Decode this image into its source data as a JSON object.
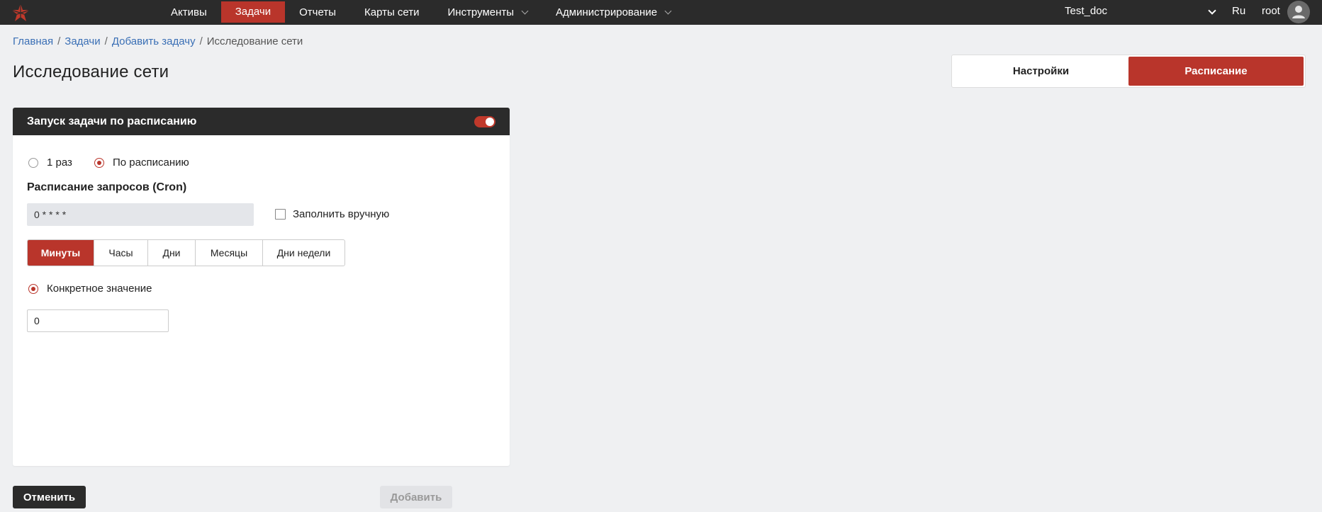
{
  "nav": {
    "items": [
      {
        "label": "Активы",
        "active": false,
        "has_dropdown": false
      },
      {
        "label": "Задачи",
        "active": true,
        "has_dropdown": false
      },
      {
        "label": "Отчеты",
        "active": false,
        "has_dropdown": false
      },
      {
        "label": "Карты сети",
        "active": false,
        "has_dropdown": false
      },
      {
        "label": "Инструменты",
        "active": false,
        "has_dropdown": true
      },
      {
        "label": "Администрирование",
        "active": false,
        "has_dropdown": true
      }
    ],
    "project": "Test_doc",
    "lang": "Ru",
    "user": "root"
  },
  "breadcrumb": {
    "home": "Главная",
    "tasks": "Задачи",
    "add_task": "Добавить задачу",
    "current": "Исследование сети"
  },
  "page": {
    "title": "Исследование сети"
  },
  "tabs": {
    "settings": "Настройки",
    "schedule": "Расписание",
    "active": "schedule"
  },
  "panel": {
    "header": "Запуск задачи по расписанию",
    "toggle_on": true,
    "radio_once": "1 раз",
    "radio_scheduled": "По расписанию",
    "section_title": "Расписание запросов (Cron)",
    "cron_value": "0 * * * *",
    "manual_fill_label": "Заполнить вручную",
    "segments": [
      "Минуты",
      "Часы",
      "Дни",
      "Месяцы",
      "Дни недели"
    ],
    "active_segment": "Минуты",
    "specific_value_label": "Конкретное значение",
    "specific_value": "0"
  },
  "footer": {
    "cancel": "Отменить",
    "add": "Добавить"
  },
  "colors": {
    "accent": "#b9352b",
    "topbar": "#2b2b2b",
    "background": "#eff0f2"
  }
}
